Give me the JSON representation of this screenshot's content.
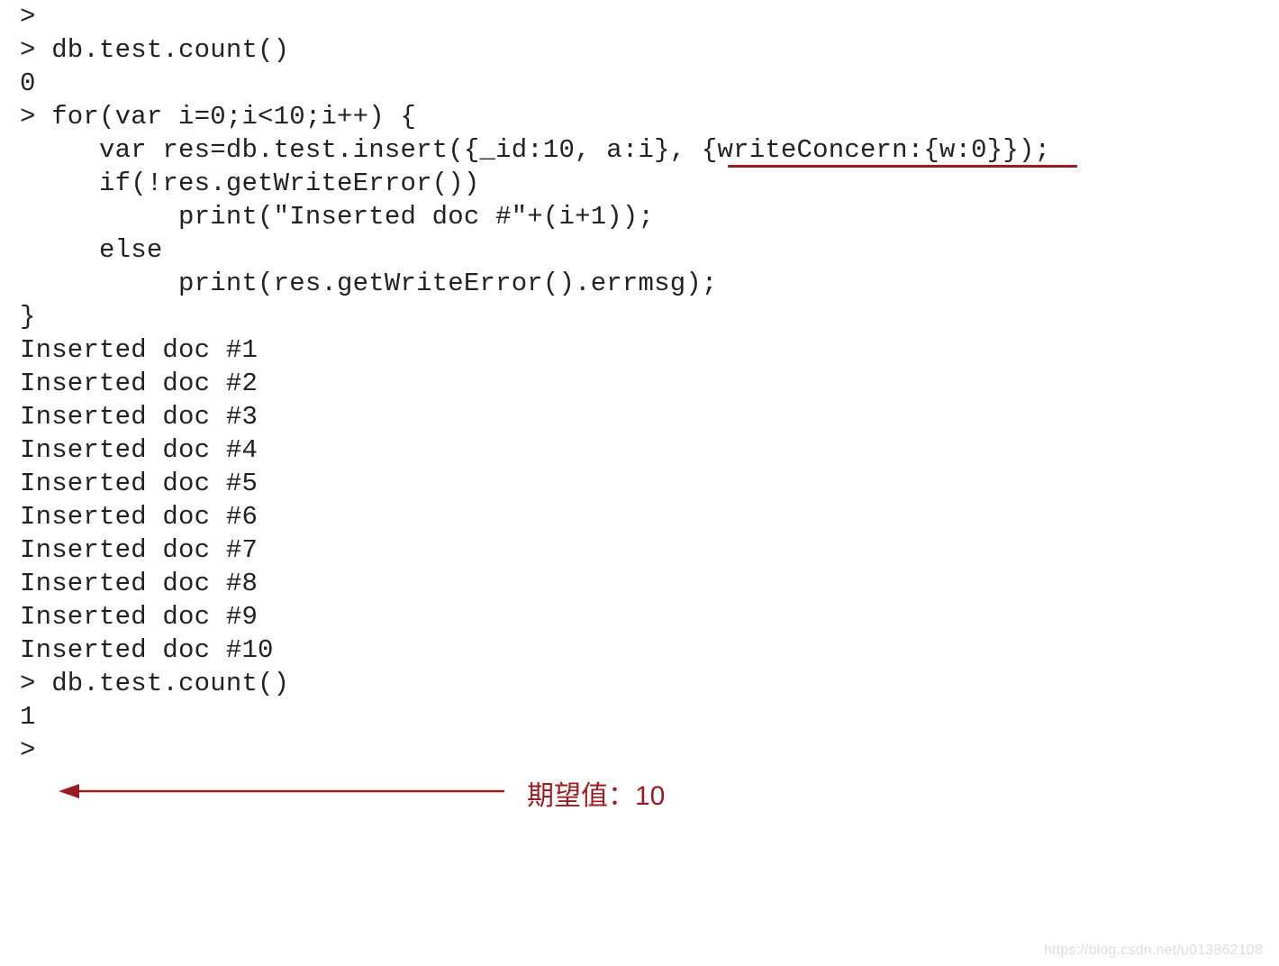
{
  "lines": {
    "l0": ">",
    "l1": "> db.test.count()",
    "l2": "0",
    "l3": "> for(var i=0;i<10;i++) {",
    "l4": "     var res=db.test.insert({_id:10, a:i}, {writeConcern:{w:0}});",
    "l5": "     if(!res.getWriteError())",
    "l6": "          print(\"Inserted doc #\"+(i+1));",
    "l7": "     else",
    "l8": "          print(res.getWriteError().errmsg);",
    "l9": "}",
    "blank1": "",
    "o1": "Inserted doc #1",
    "o2": "Inserted doc #2",
    "o3": "Inserted doc #3",
    "o4": "Inserted doc #4",
    "o5": "Inserted doc #5",
    "o6": "Inserted doc #6",
    "o7": "Inserted doc #7",
    "o8": "Inserted doc #8",
    "o9": "Inserted doc #9",
    "o10": "Inserted doc #10",
    "blank2": "",
    "l10": "> db.test.count()",
    "l11": "1",
    "l12": ">"
  },
  "annotation": {
    "label": "期望值：10"
  },
  "watermark": "https://blog.csdn.net/u013862108"
}
